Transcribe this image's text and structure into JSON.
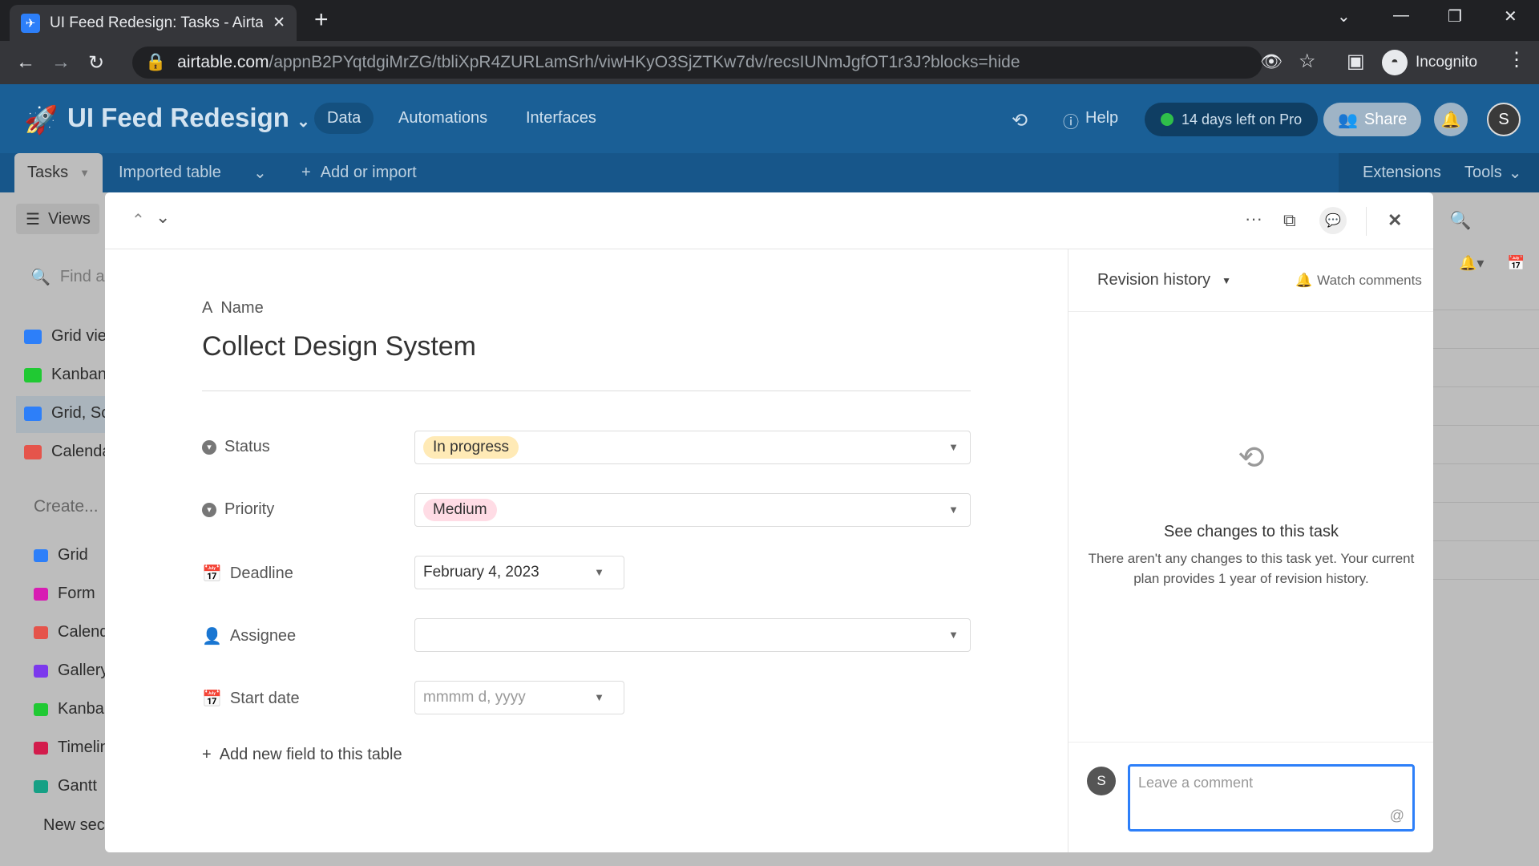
{
  "browser": {
    "tab_title": "UI Feed Redesign: Tasks - Airtable",
    "url_host": "airtable.com",
    "url_path": "/appnB2PYqtdgiMrZG/tbliXpR4ZURLamSrh/viwHKyO3SjZTKw7dv/recsIUNmJgfOT1r3J?blocks=hide",
    "profile": "Incognito"
  },
  "header": {
    "app_name": "UI Feed Redesign",
    "nav": [
      "Data",
      "Automations",
      "Interfaces"
    ],
    "help": "Help",
    "trial": "14 days left on Pro",
    "share": "Share",
    "avatar": "S"
  },
  "tables": {
    "active": "Tasks",
    "other": "Imported table",
    "add": "Add or import",
    "extensions": "Extensions",
    "tools": "Tools"
  },
  "sidebar": {
    "views_button": "Views",
    "find_placeholder": "Find a view",
    "views": [
      {
        "label": "Grid view",
        "color": "#2d7ff9"
      },
      {
        "label": "Kanban",
        "color": "#20c933"
      },
      {
        "label": "Grid, Sc",
        "color": "#2d7ff9"
      },
      {
        "label": "Calendar",
        "color": "#e5544b"
      }
    ],
    "create_label": "Create...",
    "create": [
      {
        "label": "Grid",
        "color": "#2d7ff9"
      },
      {
        "label": "Form",
        "color": "#d81cb3"
      },
      {
        "label": "Calendar",
        "color": "#e5544b"
      },
      {
        "label": "Gallery",
        "color": "#7c39ed"
      },
      {
        "label": "Kanban",
        "color": "#20c933"
      },
      {
        "label": "Timeline",
        "color": "#d31c4c"
      },
      {
        "label": "Gantt",
        "color": "#16a085"
      }
    ],
    "new_section": "New section"
  },
  "record": {
    "name_label": "Name",
    "name": "Collect Design System",
    "fields": [
      {
        "label": "Status",
        "value": "In progress",
        "color": "#ffeab6"
      },
      {
        "label": "Priority",
        "value": "Medium",
        "color": "#ffdce5"
      },
      {
        "label": "Deadline",
        "value": "February 4, 2023"
      },
      {
        "label": "Assignee",
        "value": ""
      },
      {
        "label": "Start date",
        "placeholder": "mmmm d, yyyy"
      }
    ],
    "add_field": "Add new field to this table"
  },
  "panel": {
    "revision_history": "Revision history",
    "watch": "Watch comments",
    "empty_title": "See changes to this task",
    "empty_desc_1": "There aren't any changes to this task yet. Your current",
    "empty_desc_2": "plan provides 1 year of revision history.",
    "comment_placeholder": "Leave a comment",
    "avatar": "S"
  }
}
